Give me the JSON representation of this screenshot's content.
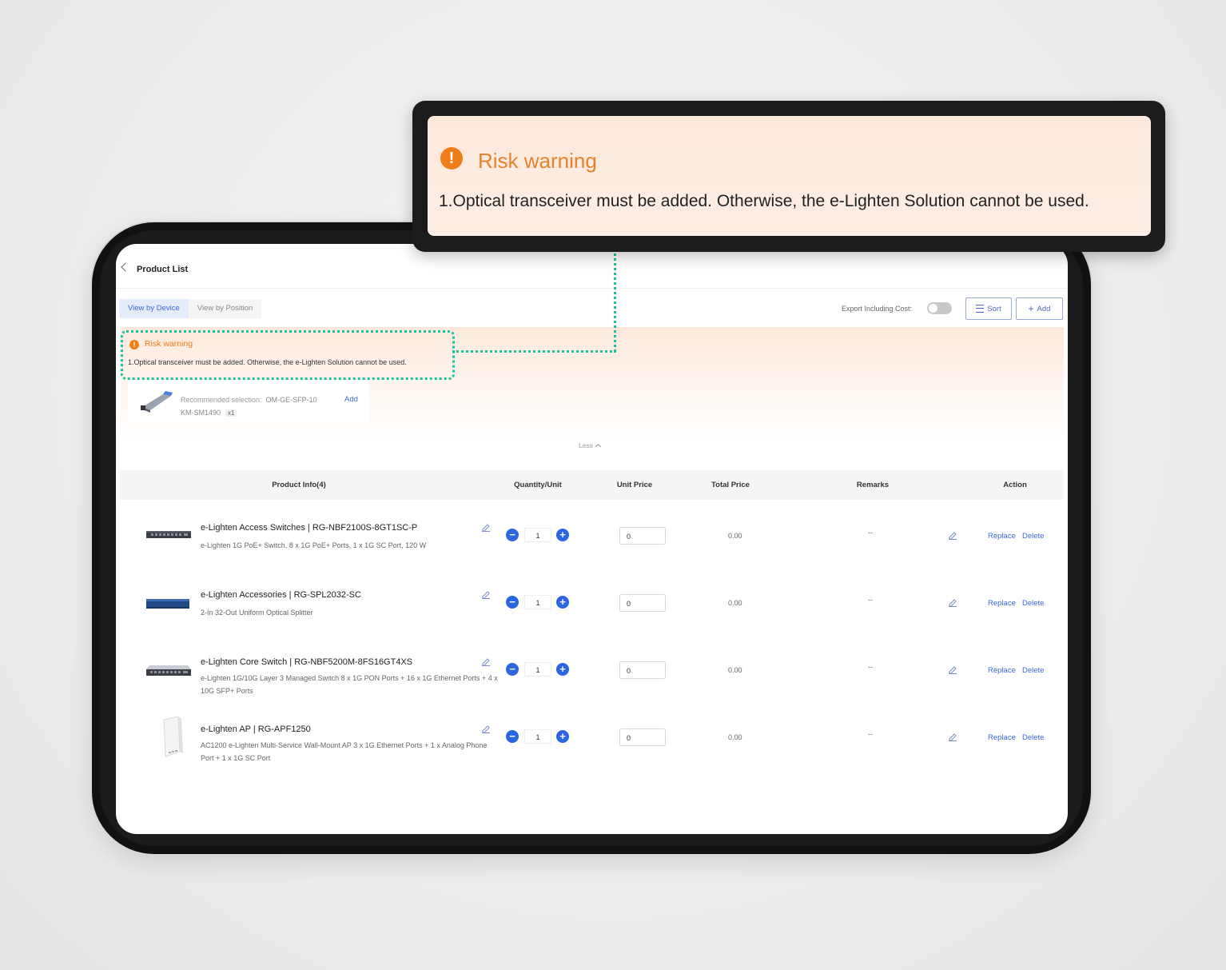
{
  "header": {
    "title": "Product List"
  },
  "tabs": [
    {
      "label": "View by Device"
    },
    {
      "label": "View by Position"
    }
  ],
  "toolbar": {
    "export_label": "Export Including Cost:",
    "sort_label": "Sort",
    "add_label": "Add"
  },
  "warning": {
    "title": "Risk warning",
    "message": "1.Optical transceiver must be added. Otherwise, the e-Lighten Solution cannot be used.",
    "recommended_label": "Recommended selection:",
    "recommended_value": "OM-GE-SFP-10",
    "recommended_value_line2": "KM-SM1490",
    "recommended_qty": "x1",
    "add_label": "Add",
    "less_label": "Less"
  },
  "table": {
    "headers": {
      "product_info": "Product Info(4)",
      "quantity": "Quantity/Unit",
      "unit_price": "Unit Price",
      "total_price": "Total Price",
      "remarks": "Remarks",
      "action": "Action"
    },
    "rows": [
      {
        "name": "e-Lighten Access Switches | RG-NBF2100S-8GT1SC-P",
        "desc": "e-Lighten 1G PoE+ Switch, 8 x 1G PoE+ Ports, 1 x 1G SC Port, 120 W",
        "qty": "1",
        "unit_price": "0",
        "total": "0.00",
        "remarks": "--",
        "replace": "Replace",
        "delete": "Delete"
      },
      {
        "name": "e-Lighten Accessories | RG-SPL2032-SC",
        "desc": "2-In 32-Out Uniform Optical Splitter",
        "qty": "1",
        "unit_price": "0",
        "total": "0.00",
        "remarks": "--",
        "replace": "Replace",
        "delete": "Delete"
      },
      {
        "name": "e-Lighten Core Switch | RG-NBF5200M-8FS16GT4XS",
        "desc": "e-Lighten 1G/10G Layer 3 Managed Switch 8 x 1G PON Ports + 16 x 1G Ethernet Ports + 4 x 10G SFP+ Ports",
        "qty": "1",
        "unit_price": "0",
        "total": "0.00",
        "remarks": "--",
        "replace": "Replace",
        "delete": "Delete"
      },
      {
        "name": "e-Lighten AP | RG-APF1250",
        "desc": "AC1200 e-Lighten Multi-Service Wall-Mount AP 3 x 1G Ethernet Ports + 1 x Analog Phone Port + 1 x 1G SC Port",
        "qty": "1",
        "unit_price": "0",
        "total": "0.00",
        "remarks": "--",
        "replace": "Replace",
        "delete": "Delete"
      }
    ]
  },
  "colors": {
    "accent": "#2b65e0",
    "link": "#3b6ad8",
    "warning": "#ef7d1a",
    "highlight": "#19c49d"
  },
  "icons": {
    "back": "chevron-left-icon",
    "sort": "list-icon",
    "add": "plus-icon",
    "warning": "exclamation-circle-icon",
    "edit": "pencil-icon"
  }
}
